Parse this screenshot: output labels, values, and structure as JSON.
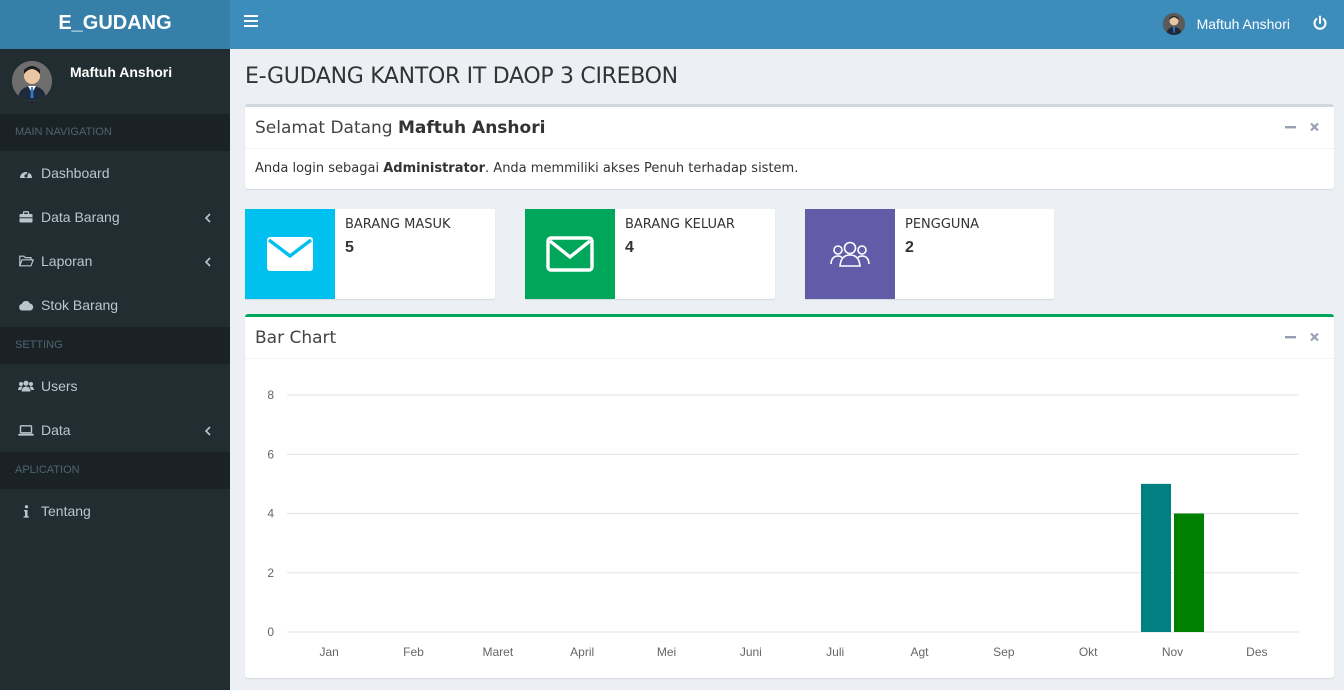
{
  "header": {
    "logo": "E_GUDANG",
    "user_name": "Maftuh Anshori"
  },
  "sidebar": {
    "user_name": "Maftuh Anshori",
    "sections": [
      {
        "title": "MAIN NAVIGATION",
        "items": [
          {
            "label": "Dashboard",
            "icon": "dashboard-icon",
            "has_submenu": false
          },
          {
            "label": "Data Barang",
            "icon": "briefcase-icon",
            "has_submenu": true
          },
          {
            "label": "Laporan",
            "icon": "folder-open-icon",
            "has_submenu": true
          },
          {
            "label": "Stok Barang",
            "icon": "cloud-icon",
            "has_submenu": false
          }
        ]
      },
      {
        "title": "SETTING",
        "items": [
          {
            "label": "Users",
            "icon": "users-icon",
            "has_submenu": false
          },
          {
            "label": "Data",
            "icon": "laptop-icon",
            "has_submenu": true
          }
        ]
      },
      {
        "title": "APLICATION",
        "items": [
          {
            "label": "Tentang",
            "icon": "info-icon",
            "has_submenu": false
          }
        ]
      }
    ]
  },
  "page": {
    "title": "E-GUDANG KANTOR IT DAOP 3 CIREBON"
  },
  "welcome": {
    "greeting": "Selamat Datang ",
    "user_name": "Maftuh Anshori",
    "body_prefix": "Anda login sebagai ",
    "role": "Administrator",
    "body_suffix": ". Anda memmiliki akses Penuh terhadap sistem."
  },
  "info_boxes": [
    {
      "label": "BARANG MASUK",
      "value": "5",
      "color": "#00c0ef",
      "icon": "envelope-icon"
    },
    {
      "label": "BARANG KELUAR",
      "value": "4",
      "color": "#00a65a",
      "icon": "envelope-icon"
    },
    {
      "label": "PENGGUNA",
      "value": "2",
      "color": "#605ca8",
      "icon": "users-icon"
    }
  ],
  "chart_box": {
    "title": "Bar Chart"
  },
  "chart_data": {
    "type": "bar",
    "categories": [
      "Jan",
      "Feb",
      "Maret",
      "April",
      "Mei",
      "Juni",
      "Juli",
      "Agt",
      "Sep",
      "Okt",
      "Nov",
      "Des"
    ],
    "series": [
      {
        "color": "#008080",
        "values": [
          0,
          0,
          0,
          0,
          0,
          0,
          0,
          0,
          0,
          0,
          5,
          0
        ]
      },
      {
        "color": "#008000",
        "values": [
          0,
          0,
          0,
          0,
          0,
          0,
          0,
          0,
          0,
          0,
          4,
          0
        ]
      }
    ],
    "ylim": [
      0,
      8
    ],
    "yticks": [
      0,
      2,
      4,
      6,
      8
    ],
    "grid": true,
    "title": "",
    "xlabel": "",
    "ylabel": ""
  },
  "colors": {
    "header": "#3c8dbc",
    "logo_bg": "#367fa9",
    "sidebar": "#222d32",
    "content_bg": "#ecf0f5"
  }
}
